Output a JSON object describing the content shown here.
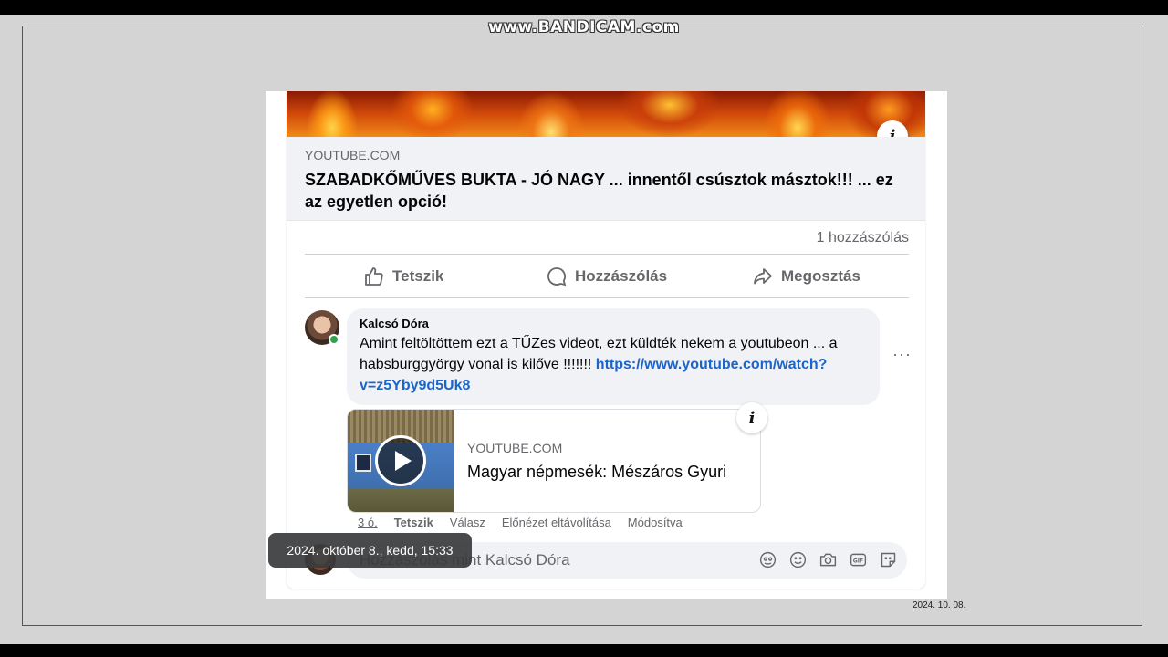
{
  "watermark": "www.BANDICAM.com",
  "recording_date": "2024. 10. 08.",
  "post": {
    "link_preview": {
      "domain": "YOUTUBE.COM",
      "title": "SZABADKŐMŰVES BUKTA - JÓ NAGY ... innentől csúsztok másztok!!! ... ez az egyetlen opció!"
    },
    "comment_count": "1 hozzászólás",
    "actions": {
      "like": "Tetszik",
      "comment": "Hozzászólás",
      "share": "Megosztás"
    }
  },
  "comment": {
    "author": "Kalcsó Dóra",
    "text": "Amint feltöltöttem ezt a TŰZes videot, ezt küldték nekem a youtubeon ... a habsburggyörgy vonal is kilőve !!!!!!! ",
    "link": "https://www.youtube.com/watch?v=z5Yby9d5Uk8",
    "more": "···",
    "embed": {
      "domain": "YOUTUBE.COM",
      "title": "Magyar népmesék: Mészáros Gyuri"
    },
    "meta": {
      "time": "3 ó.",
      "like": "Tetszik",
      "reply": "Válasz",
      "remove_preview": "Előnézet eltávolítása",
      "edited": "Módosítva"
    }
  },
  "reply_box": {
    "placeholder": "Hozzászólás mint Kalcsó Dóra",
    "icons": [
      "avatar-sticker-icon",
      "emoji-icon",
      "camera-icon",
      "gif-icon",
      "sticker-icon"
    ]
  },
  "tooltip": "2024. október 8., kedd, 15:33",
  "colors": {
    "link": "#1b65c9",
    "secondary_text": "#65676b",
    "bubble_bg": "#f0f2f5",
    "online": "#31a24c"
  }
}
